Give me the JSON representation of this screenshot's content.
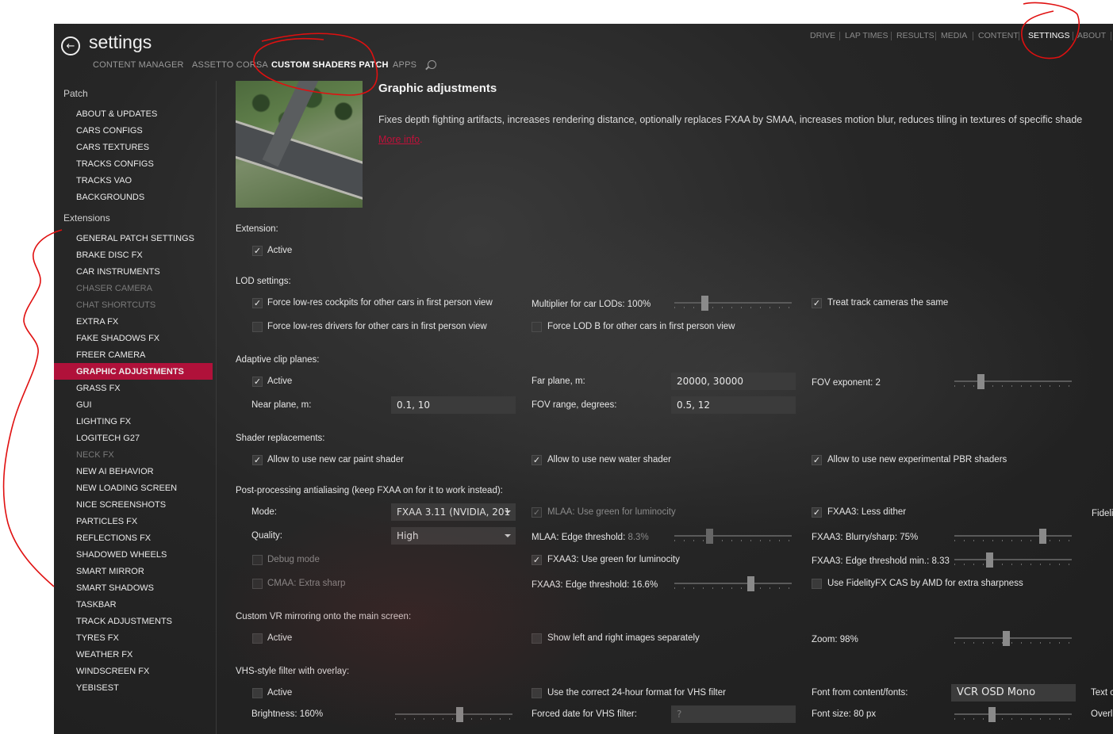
{
  "header": {
    "title": "settings",
    "subtabs": [
      "CONTENT MANAGER",
      "ASSETTO CORSA",
      "CUSTOM SHADERS PATCH",
      "APPS"
    ],
    "active_subtab": "CUSTOM SHADERS PATCH",
    "toptabs": [
      "DRIVE",
      "LAP TIMES",
      "RESULTS",
      "MEDIA",
      "CONTENT",
      "SETTINGS",
      "ABOUT"
    ],
    "active_toptab": "SETTINGS"
  },
  "sidebar": {
    "patch_header": "Patch",
    "patch_items": [
      "ABOUT & UPDATES",
      "CARS CONFIGS",
      "CARS TEXTURES",
      "TRACKS CONFIGS",
      "TRACKS VAO",
      "BACKGROUNDS"
    ],
    "extensions_header": "Extensions",
    "extension_items": [
      "GENERAL PATCH SETTINGS",
      "BRAKE DISC FX",
      "CAR INSTRUMENTS",
      "CHASER CAMERA",
      "CHAT SHORTCUTS",
      "EXTRA FX",
      "FAKE SHADOWS FX",
      "FREER CAMERA",
      "GRAPHIC ADJUSTMENTS",
      "GRASS FX",
      "GUI",
      "LIGHTING FX",
      "LOGITECH G27",
      "NECK FX",
      "NEW AI BEHAVIOR",
      "NEW LOADING SCREEN",
      "NICE SCREENSHOTS",
      "PARTICLES FX",
      "REFLECTIONS FX",
      "SHADOWED WHEELS",
      "SMART MIRROR",
      "SMART SHADOWS",
      "TASKBAR",
      "TRACK ADJUSTMENTS",
      "TYRES FX",
      "WEATHER FX",
      "WINDSCREEN FX",
      "YEBISEST"
    ],
    "selected": "GRAPHIC ADJUSTMENTS"
  },
  "main": {
    "heading": "Graphic adjustments",
    "description": "Fixes depth fighting artifacts, increases rendering distance, optionally replaces FXAA by SMAA, increases motion blur, reduces tiling in textures of specific shade",
    "more_info": "More info",
    "more_info_suffix": ".",
    "extension": {
      "header": "Extension:",
      "active_label": "Active",
      "active_checked": true
    },
    "lod": {
      "header": "LOD settings:",
      "force_cockpits": "Force low-res cockpits for other cars in first person view",
      "force_cockpits_checked": true,
      "force_drivers": "Force low-res drivers for other cars in first person view",
      "force_drivers_checked": false,
      "multiplier_label": "Multiplier for car LODs: 100%",
      "multiplier_value": 0.26,
      "force_lod_b": "Force LOD B for other cars in first person view",
      "force_lod_b_checked": false,
      "treat_track": "Treat track cameras the same",
      "treat_track_checked": true
    },
    "clip": {
      "header": "Adaptive clip planes:",
      "active_label": "Active",
      "active_checked": true,
      "near_label": "Near plane, m:",
      "near_value": "0.1, 10",
      "far_label": "Far plane, m:",
      "far_value": "20000, 30000",
      "fov_range_label": "FOV range, degrees:",
      "fov_range_value": "0.5, 12",
      "fov_exp_label": "FOV exponent: 2",
      "fov_exp_value": 0.22
    },
    "shaders": {
      "header": "Shader replacements:",
      "car_paint": "Allow to use new car paint shader",
      "water": "Allow to use new water shader",
      "pbr": "Allow to use new experimental PBR shaders"
    },
    "aa": {
      "header": "Post-processing antialiasing (keep FXAA on for it to work instead):",
      "mode_label": "Mode:",
      "mode_value": "FXAA 3.11 (NVIDIA, 201",
      "quality_label": "Quality:",
      "quality_value": "High",
      "debug_label": "Debug mode",
      "cmaa_label": "CMAA: Extra sharp",
      "mlaa_green": "MLAA: Use green for luminocity",
      "mlaa_edge_prefix": "MLAA: Edge threshold: ",
      "mlaa_edge_value": "8.3%",
      "mlaa_slider": 0.3,
      "fxaa_green": "FXAA3: Use green for luminocity",
      "fxaa_edge": "FXAA3: Edge threshold: 16.6%",
      "fxaa_edge_slider": 0.65,
      "less_dither": "FXAA3: Less dither",
      "blurry": "FXAA3: Blurry/sharp: 75%",
      "blurry_slider": 0.75,
      "edge_min": "FXAA3: Edge threshold min.: 8.33",
      "edge_min_slider": 0.3,
      "fidelity": "Use FidelityFX CAS by AMD for extra sharpness",
      "fideli_cut": "Fideli"
    },
    "vr": {
      "header": "Custom VR mirroring onto the main screen:",
      "active_label": "Active",
      "show_lr": "Show left and right images separately",
      "zoom": "Zoom: 98%",
      "zoom_slider": 0.44
    },
    "vhs": {
      "header": "VHS-style filter with overlay:",
      "active_label": "Active",
      "brightness": "Brightness: 160%",
      "brightness_slider": 0.55,
      "use_24h": "Use the correct 24-hour format for VHS filter",
      "forced_date_label": "Forced date for VHS filter:",
      "forced_date_placeholder": "?",
      "font_label": "Font from content/fonts:",
      "font_value": "VCR OSD Mono",
      "font_size": "Font size: 80 px",
      "font_size_slider": 0.32,
      "text_cut": "Text c",
      "overla_cut": "Overla"
    }
  },
  "colors": {
    "accent": "#b0113a",
    "background": "#262626",
    "annotation": "#e01010"
  },
  "icons": [
    "back-arrow-icon",
    "search-icon",
    "checkmark-icon",
    "dropdown-caret-icon"
  ]
}
